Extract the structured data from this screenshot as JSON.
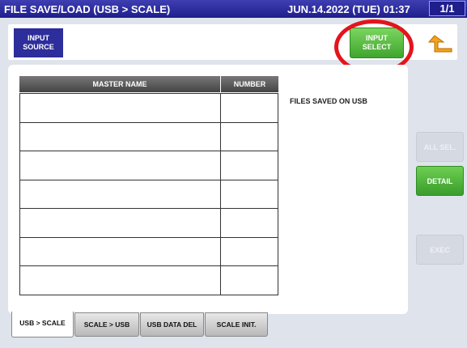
{
  "titlebar": {
    "title": "FILE SAVE/LOAD (USB > SCALE)",
    "datetime": "JUN.14.2022 (TUE) 01:37",
    "page": "1/1"
  },
  "topbar": {
    "input_source_label": "INPUT\nSOURCE",
    "input_select_label": "INPUT\nSELECT"
  },
  "table": {
    "headers": [
      "MASTER NAME",
      "NUMBER"
    ],
    "rows": [
      [
        "",
        ""
      ],
      [
        "",
        ""
      ],
      [
        "",
        ""
      ],
      [
        "",
        ""
      ],
      [
        "",
        ""
      ],
      [
        "",
        ""
      ],
      [
        "",
        ""
      ]
    ]
  },
  "files_label": "FILES SAVED ON USB",
  "side_buttons": {
    "all_sel": "ALL SEL.",
    "detail": "DETAIL",
    "exec": "EXEC"
  },
  "tabs": [
    "USB > SCALE",
    "SCALE > USB",
    "USB DATA DEL",
    "SCALE INIT."
  ],
  "colors": {
    "titlebar": "#1e1e8c",
    "accent_green": "#4fb53a",
    "highlight_circle": "#e4141c"
  },
  "icons": {
    "back": "return-arrow-icon"
  }
}
